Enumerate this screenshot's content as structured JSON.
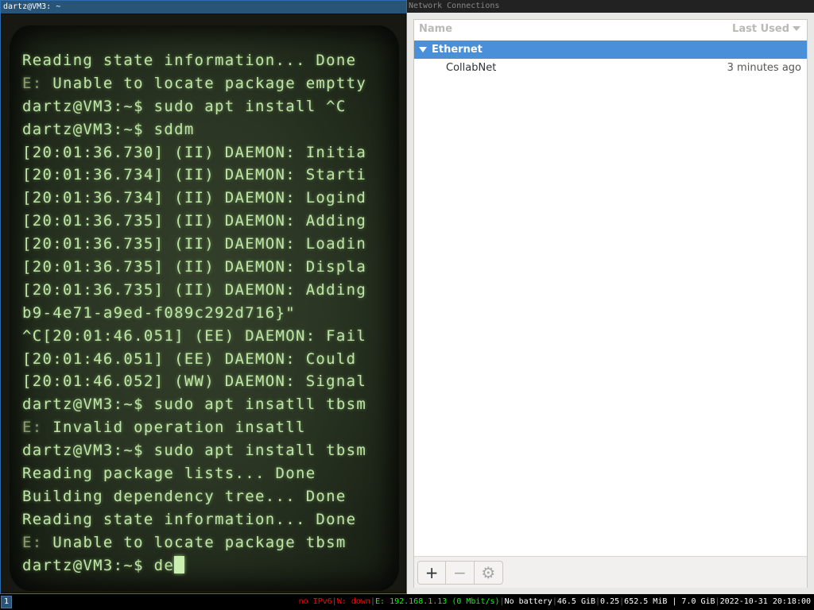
{
  "terminal": {
    "title": "dartz@VM3: ~",
    "lines": [
      {
        "prefix": "",
        "text": "Reading state information... Done"
      },
      {
        "prefix": "E:",
        "text": " Unable to locate package emptty"
      },
      {
        "prefix": "",
        "text": "dartz@VM3:~$ sudo apt install ^C"
      },
      {
        "prefix": "",
        "text": "dartz@VM3:~$ sddm"
      },
      {
        "prefix": "",
        "text": "[20:01:36.730] (II) DAEMON: Initia"
      },
      {
        "prefix": "",
        "text": "[20:01:36.734] (II) DAEMON: Starti"
      },
      {
        "prefix": "",
        "text": "[20:01:36.734] (II) DAEMON: Logind"
      },
      {
        "prefix": "",
        "text": "[20:01:36.735] (II) DAEMON: Adding"
      },
      {
        "prefix": "",
        "text": "[20:01:36.735] (II) DAEMON: Loadin"
      },
      {
        "prefix": "",
        "text": "[20:01:36.735] (II) DAEMON: Displa"
      },
      {
        "prefix": "",
        "text": "[20:01:36.735] (II) DAEMON: Adding"
      },
      {
        "prefix": "",
        "text": "b9-4e71-a9ed-f089c292d716}\""
      },
      {
        "prefix": "",
        "text": "^C[20:01:46.051] (EE) DAEMON: Fail"
      },
      {
        "prefix": "",
        "text": "[20:01:46.051] (EE) DAEMON: Could"
      },
      {
        "prefix": "",
        "text": "[20:01:46.052] (WW) DAEMON: Signal"
      },
      {
        "prefix": "",
        "text": "dartz@VM3:~$ sudo apt insatll tbsm"
      },
      {
        "prefix": "E:",
        "text": " Invalid operation insatll"
      },
      {
        "prefix": "",
        "text": "dartz@VM3:~$ sudo apt install tbsm"
      },
      {
        "prefix": "",
        "text": "Reading package lists... Done"
      },
      {
        "prefix": "",
        "text": "Building dependency tree... Done"
      },
      {
        "prefix": "",
        "text": "Reading state information... Done"
      },
      {
        "prefix": "E:",
        "text": " Unable to locate package tbsm"
      },
      {
        "prefix": "",
        "text": "dartz@VM3:~$ de"
      }
    ],
    "text_color": "#bfe6a6"
  },
  "network": {
    "title": "Network Connections",
    "columns": {
      "name": "Name",
      "last_used": "Last Used"
    },
    "groups": [
      {
        "label": "Ethernet",
        "connections": [
          {
            "name": "CollabNet",
            "last_used": "3 minutes ago"
          }
        ]
      }
    ],
    "toolbar": {
      "add": "+",
      "remove": "−",
      "settings": "⚙"
    },
    "selection_color": "#4a90d9"
  },
  "statusbar": {
    "workspace": "1",
    "ipv6": "no IPv6",
    "wireless": "W: down",
    "ethernet": "E: 192.168.1.13 (0 Mbit/s)",
    "battery": "No battery",
    "disk": "46.5 GiB",
    "load": "0.25",
    "memory": "652.5 MiB",
    "memory_total": "7.0 GiB",
    "datetime": "2022-10-31 20:18:00"
  }
}
